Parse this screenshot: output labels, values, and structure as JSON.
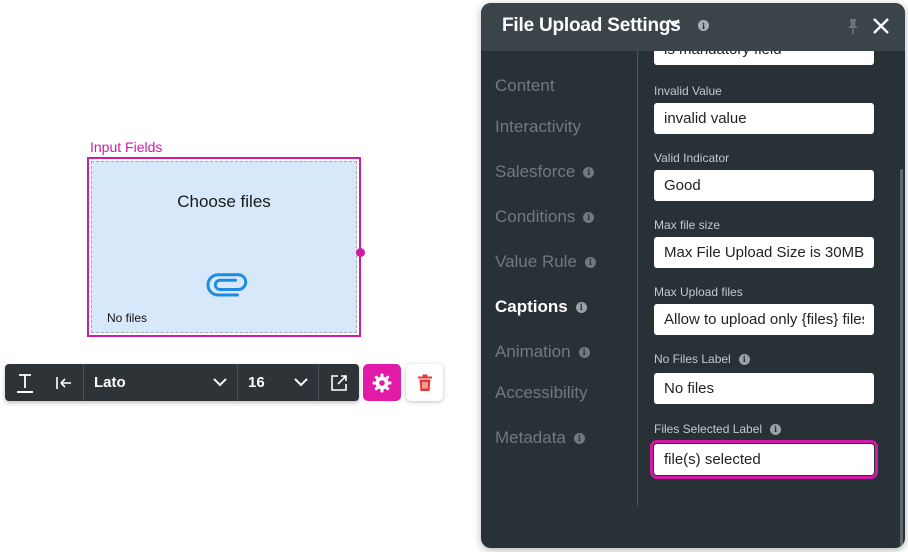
{
  "canvas": {
    "widget_label": "Input Fields",
    "choose_text": "Choose files",
    "no_files_text": "No files"
  },
  "toolbar": {
    "font_family": "Lato",
    "font_size": "16"
  },
  "panel": {
    "title": "File Upload Settings",
    "nav": [
      {
        "label": "Content",
        "info": false,
        "active": false
      },
      {
        "label": "Interactivity",
        "info": false,
        "active": false
      },
      {
        "label": "Salesforce",
        "info": true,
        "active": false
      },
      {
        "label": "Conditions",
        "info": true,
        "active": false
      },
      {
        "label": "Value Rule",
        "info": true,
        "active": false
      },
      {
        "label": "Captions",
        "info": true,
        "active": true
      },
      {
        "label": "Animation",
        "info": true,
        "active": false
      },
      {
        "label": "Accessibility",
        "info": false,
        "active": false
      },
      {
        "label": "Metadata",
        "info": true,
        "active": false
      }
    ],
    "fields": {
      "mandatory_value": "is mandatory field",
      "invalid_value": {
        "label": "Invalid Value",
        "value": "invalid value"
      },
      "valid_indicator": {
        "label": "Valid Indicator",
        "value": "Good"
      },
      "max_file_size": {
        "label": "Max file size",
        "value": "Max File Upload Size is 30MB"
      },
      "max_upload_files": {
        "label": "Max Upload files",
        "value": "Allow to upload only {files} files"
      },
      "no_files_label": {
        "label": "No Files Label",
        "value": "No files"
      },
      "files_selected_label": {
        "label": "Files Selected Label",
        "value": "file(s) selected"
      }
    }
  },
  "colors": {
    "accent": "#d11aa5",
    "panel_bg": "#283136",
    "widget_fill": "#d6e8fa",
    "clip_blue": "#1e8be0"
  }
}
